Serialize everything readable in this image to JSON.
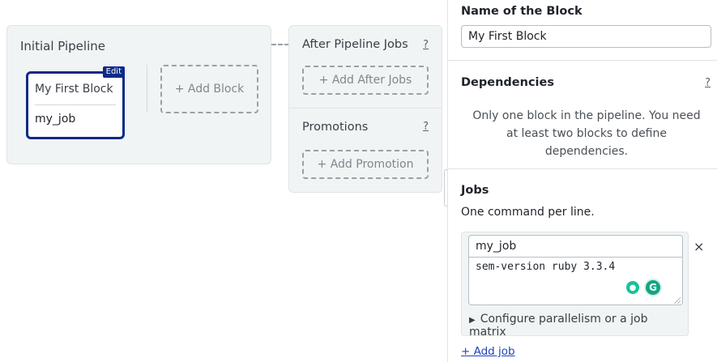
{
  "workflow": {
    "initial_pipeline": {
      "title": "Initial Pipeline",
      "block": {
        "name": "My First Block",
        "edit_badge": "Edit",
        "jobs": [
          "my_job"
        ]
      },
      "add_block_label": "+ Add Block"
    },
    "after_pipeline": {
      "title": "After Pipeline Jobs",
      "help": "?",
      "add_label": "+ Add After Jobs"
    },
    "promotions": {
      "title": "Promotions",
      "help": "?",
      "add_label": "+ Add Promotion"
    }
  },
  "panel": {
    "name_label": "Name of the Block",
    "name_value": "My First Block",
    "dependencies": {
      "title": "Dependencies",
      "help": "?",
      "message": "Only one block in the pipeline. You need at least two blocks to define dependencies."
    },
    "jobs": {
      "title": "Jobs",
      "help_text": "One command per line.",
      "items": [
        {
          "name": "my_job",
          "commands": "sem-version ruby 3.3.4"
        }
      ],
      "config_label": "Configure parallelism or a job matrix",
      "remove_symbol": "×",
      "add_job_label": "+ Add job"
    }
  },
  "colors": {
    "accent_block_border": "#0d2a86",
    "link": "#1f45b8",
    "card_bg": "#f1f4f5"
  }
}
